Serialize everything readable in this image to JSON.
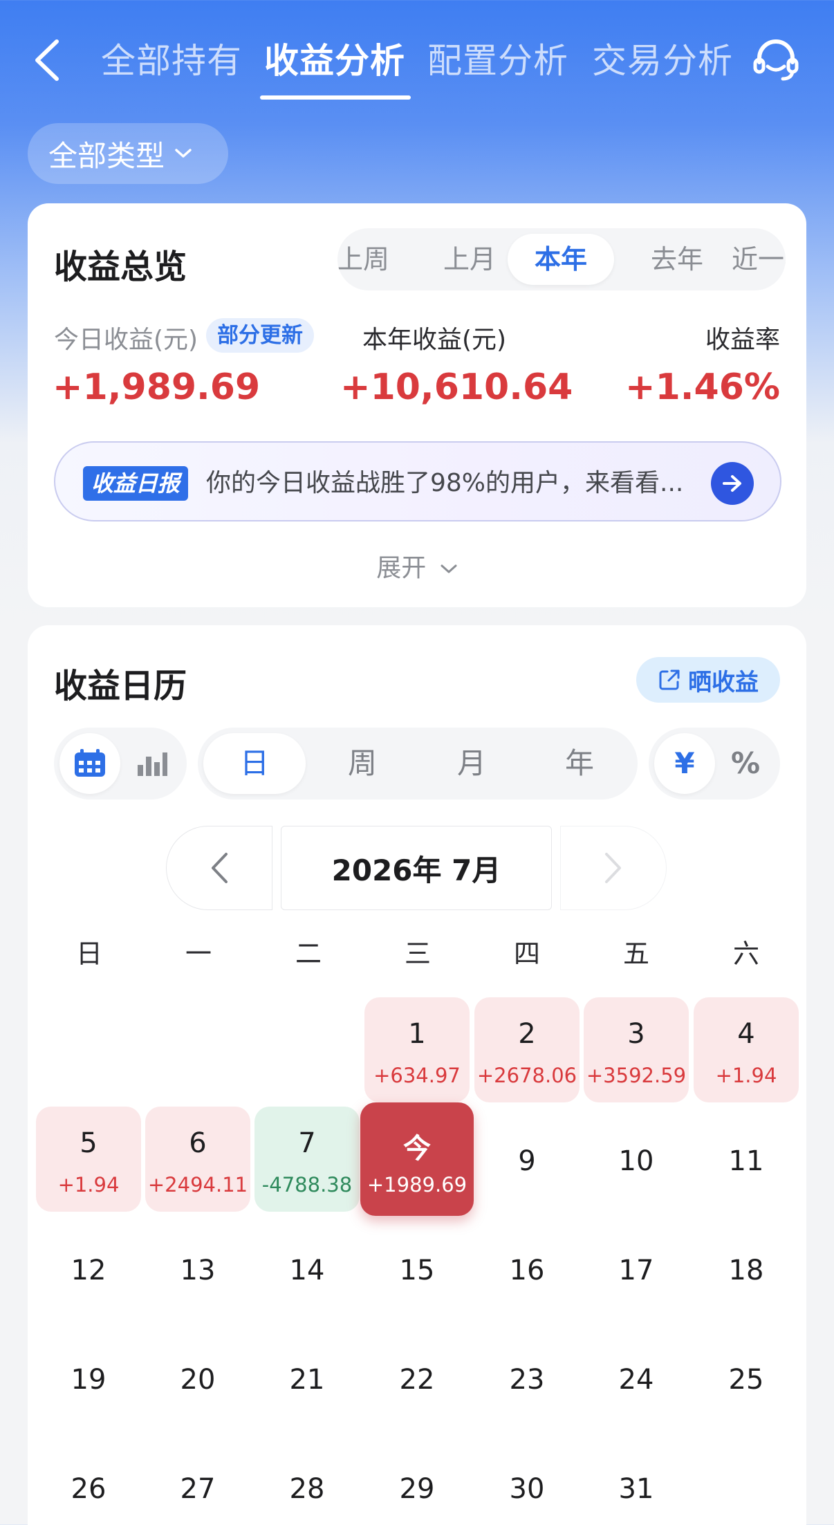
{
  "header": {
    "tabs": [
      {
        "label": "全部持有"
      },
      {
        "label": "收益分析"
      },
      {
        "label": "配置分析"
      },
      {
        "label": "交易分析"
      }
    ],
    "active_tab": "收益分析"
  },
  "filter": {
    "label": "全部类型"
  },
  "overview": {
    "title": "收益总览",
    "periods": [
      "上周",
      "上月",
      "本年",
      "去年",
      "近一年"
    ],
    "active_period": "本年",
    "today_label": "今日收益(元)",
    "today_badge": "部分更新",
    "today_value": "+1,989.69",
    "year_label": "本年收益(元)",
    "year_value": "+10,610.64",
    "rate_label": "收益率",
    "rate_value": "+1.46%",
    "report_tag": "收益日报",
    "report_text": "你的今日收益战胜了98%的用户，来看看...",
    "expand_label": "展开"
  },
  "calendar": {
    "title": "收益日历",
    "share_label": "晒收益",
    "granularity": [
      "日",
      "周",
      "月",
      "年"
    ],
    "active_granularity": "日",
    "unit_options": [
      "¥",
      "%"
    ],
    "active_unit": "¥",
    "month_label": "2026年 7月",
    "weekdays": [
      "日",
      "一",
      "二",
      "三",
      "四",
      "五",
      "六"
    ],
    "days": [
      {
        "num": "1",
        "value": "+634.97"
      },
      {
        "num": "2",
        "value": "+2678.06"
      },
      {
        "num": "3",
        "value": "+3592.59"
      },
      {
        "num": "4",
        "value": "+1.94"
      },
      {
        "num": "5",
        "value": "+1.94"
      },
      {
        "num": "6",
        "value": "+2494.11"
      },
      {
        "num": "7",
        "value": "-4788.38"
      },
      {
        "num": "今",
        "value": "+1989.69"
      },
      {
        "num": "9"
      },
      {
        "num": "10"
      },
      {
        "num": "11"
      },
      {
        "num": "12"
      },
      {
        "num": "13"
      },
      {
        "num": "14"
      },
      {
        "num": "15"
      },
      {
        "num": "16"
      },
      {
        "num": "17"
      },
      {
        "num": "18"
      },
      {
        "num": "19"
      },
      {
        "num": "20"
      },
      {
        "num": "21"
      },
      {
        "num": "22"
      },
      {
        "num": "23"
      },
      {
        "num": "24"
      },
      {
        "num": "25"
      },
      {
        "num": "26"
      },
      {
        "num": "27"
      },
      {
        "num": "28"
      },
      {
        "num": "29"
      },
      {
        "num": "30"
      },
      {
        "num": "31"
      }
    ]
  },
  "colors": {
    "brand_blue": "#3f7ef2",
    "accent_blue": "#2d6fe6",
    "gain_red": "#d93a3d",
    "loss_green": "#2e8a5c",
    "today_red": "#c9434b"
  }
}
